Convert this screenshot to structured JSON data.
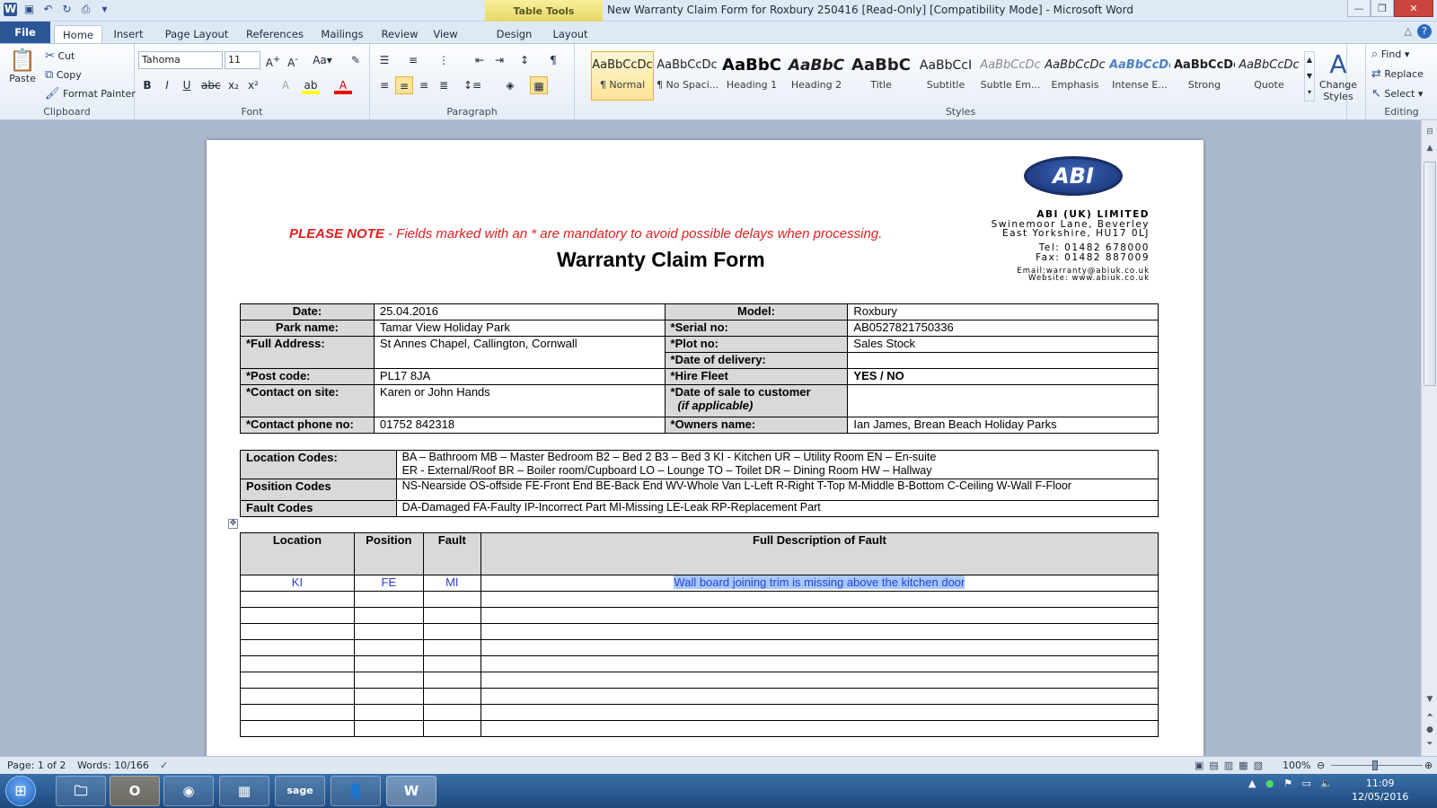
{
  "window": {
    "title": "New Warranty Claim Form for Roxbury 250416 [Read-Only] [Compatibility Mode]  -  Microsoft Word",
    "context_tab": "Table Tools"
  },
  "tabs": [
    "File",
    "Home",
    "Insert",
    "Page Layout",
    "References",
    "Mailings",
    "Review",
    "View",
    "Design",
    "Layout"
  ],
  "clipboard": {
    "paste": "Paste",
    "cut": "Cut",
    "copy": "Copy",
    "format_painter": "Format Painter",
    "group": "Clipboard"
  },
  "font": {
    "name": "Tahoma",
    "size": "11",
    "group": "Font"
  },
  "paragraph": {
    "group": "Paragraph"
  },
  "styles": {
    "group": "Styles",
    "items": [
      {
        "sample": "AaBbCcDc",
        "name": "¶ Normal"
      },
      {
        "sample": "AaBbCcDc",
        "name": "¶ No Spaci..."
      },
      {
        "sample": "AaBbC",
        "name": "Heading 1"
      },
      {
        "sample": "AaBbC",
        "name": "Heading 2"
      },
      {
        "sample": "AaBbC",
        "name": "Title"
      },
      {
        "sample": "AaBbCcI",
        "name": "Subtitle"
      },
      {
        "sample": "AaBbCcDc",
        "name": "Subtle Em..."
      },
      {
        "sample": "AaBbCcDc",
        "name": "Emphasis"
      },
      {
        "sample": "AaBbCcDc",
        "name": "Intense E..."
      },
      {
        "sample": "AaBbCcDc",
        "name": "Strong"
      },
      {
        "sample": "AaBbCcDc",
        "name": "Quote"
      }
    ],
    "change": "Change Styles"
  },
  "editing": {
    "find": "Find",
    "replace": "Replace",
    "select": "Select",
    "group": "Editing"
  },
  "doc": {
    "company": {
      "name": "ABI (UK) LIMITED",
      "address1": "Swinemoor Lane, Beverley",
      "address2": "East Yorkshire, HU17 0LJ",
      "tel": "Tel: 01482 678000",
      "fax": "Fax: 01482 887009",
      "email": "Email:warranty@abiuk.co.uk",
      "website": "Website: www.abiuk.co.uk",
      "logo": "ABI"
    },
    "note_bold": "PLEASE NOTE",
    "note_rest": " -  Fields marked with an * are mandatory to avoid possible delays when processing.",
    "title": "Warranty Claim Form",
    "details": {
      "date_label": "Date:",
      "date": "25.04.2016",
      "model_label": "Model:",
      "model": "Roxbury",
      "park_label": "Park name:",
      "park": "Tamar View Holiday Park",
      "serial_label": "*Serial no:",
      "serial": "AB0527821750336",
      "address_label": "*Full Address:",
      "address": "St Annes Chapel, Callington, Cornwall",
      "plot_label": "*Plot no:",
      "plot": "Sales Stock",
      "delivery_label": "*Date of delivery:",
      "delivery": "",
      "postcode_label": "*Post code:",
      "postcode": "PL17 8JA",
      "hire_label": "*Hire Fleet",
      "hire": " YES  /  NO",
      "contact_label": "*Contact on site:",
      "contact": "Karen or John Hands",
      "sale_label": "*Date of sale to customer",
      "sale_sub": "(if applicable)",
      "sale": "",
      "phone_label": "*Contact phone no:",
      "phone": "01752  842318",
      "owner_label": "*Owners name:",
      "owner": "Ian James, Brean Beach Holiday Parks"
    },
    "codes": {
      "location_label": "Location  Codes:",
      "location_line1": "BA – Bathroom   MB – Master Bedroom   B2 – Bed 2   B3 – Bed 3   KI - Kitchen   UR – Utility Room   EN – En-suite",
      "location_line2": "ER - External/Roof   BR – Boiler room/Cupboard   LO – Lounge   TO – Toilet   DR – Dining Room   HW – Hallway",
      "position_label": "Position Codes",
      "position": "NS-Nearside  OS-offside  FE-Front End  BE-Back End  WV-Whole Van  L-Left  R-Right  T-Top  M-Middle  B-Bottom  C-Ceiling  W-Wall  F-Floor",
      "fault_label": "Fault Codes",
      "fault": "DA-Damaged   FA-Faulty   IP-Incorrect Part   MI-Missing   LE-Leak   RP-Replacement Part"
    },
    "faults": {
      "headers": [
        "Location",
        "Position",
        "Fault",
        "Full Description of Fault"
      ],
      "row1": {
        "location": "KI",
        "position": "FE",
        "fault": "MI",
        "description": "Wall board joining trim is missing above the kitchen door"
      }
    }
  },
  "status": {
    "page": "Page: 1 of 2",
    "words": "Words: 10/166",
    "zoom": "100%"
  },
  "clock": {
    "time": "11:09",
    "date": "12/05/2016"
  }
}
